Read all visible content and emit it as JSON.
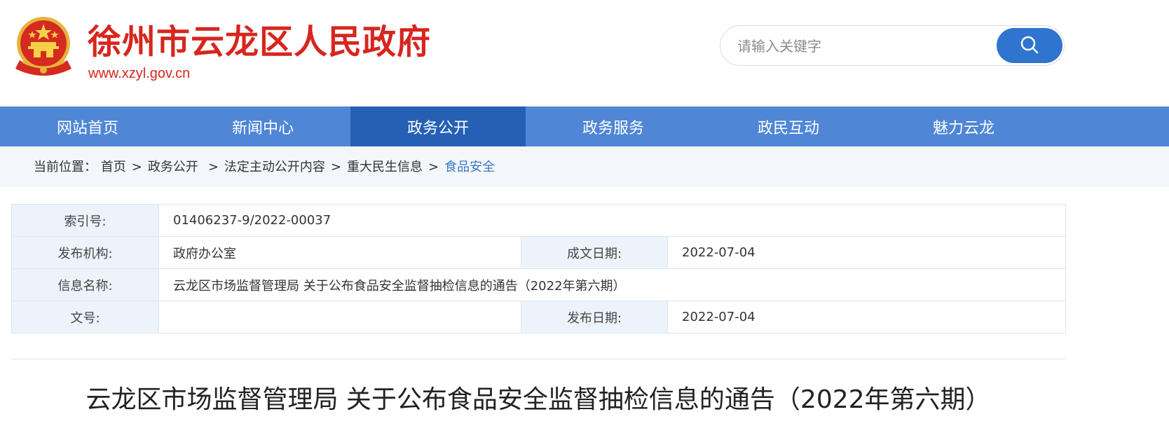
{
  "header": {
    "site_title": "徐州市云龙区人民政府",
    "site_url": "www.xzyl.gov.cn",
    "emblem_icon": "national-emblem-icon",
    "brand_color": "#d7261e"
  },
  "search": {
    "placeholder": "请输入关键字",
    "value": "",
    "button_icon": "search-icon",
    "button_color": "#2f74cf"
  },
  "nav": {
    "color": "#4f86d6",
    "active_color": "#2560b4",
    "items": [
      {
        "label": "网站首页",
        "active": false
      },
      {
        "label": "新闻中心",
        "active": false
      },
      {
        "label": "政务公开",
        "active": true
      },
      {
        "label": "政务服务",
        "active": false
      },
      {
        "label": "政民互动",
        "active": false
      },
      {
        "label": "魅力云龙",
        "active": false
      }
    ]
  },
  "breadcrumb": {
    "prefix": "当前位置：",
    "items": [
      "首页",
      "政务公开",
      "法定主动公开内容",
      "重大民生信息",
      "食品安全"
    ],
    "separator": ">"
  },
  "info": {
    "index_label": "索引号:",
    "index_value": "01406237-9/2022-00037",
    "org_label": "发布机构:",
    "org_value": "政府办公室",
    "created_label": "成文日期:",
    "created_value": "2022-07-04",
    "name_label": "信息名称:",
    "name_value": "云龙区市场监督管理局 关于公布食品安全监督抽检信息的通告（2022年第六期）",
    "docno_label": "文号:",
    "docno_value": "",
    "published_label": "发布日期:",
    "published_value": "2022-07-04"
  },
  "article": {
    "title": "云龙区市场监督管理局 关于公布食品安全监督抽检信息的通告（2022年第六期）"
  }
}
